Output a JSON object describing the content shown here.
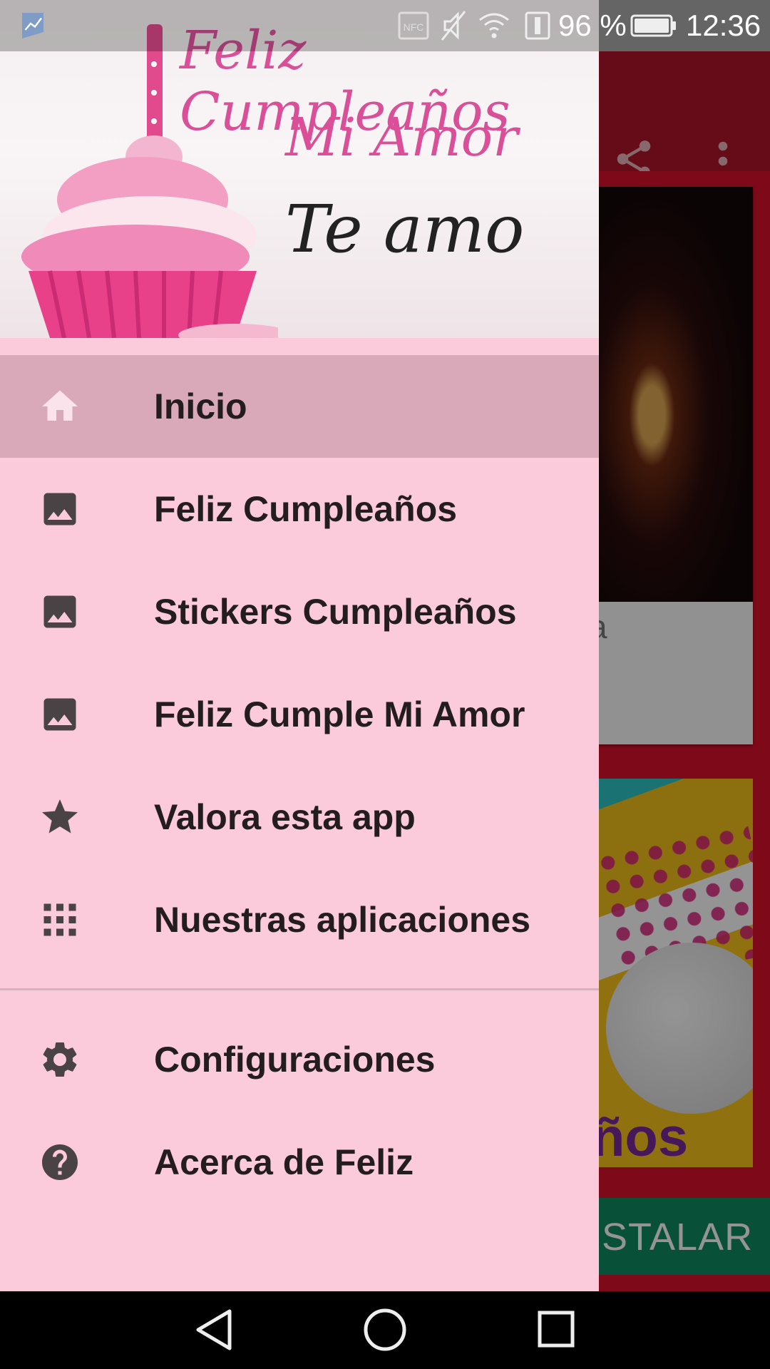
{
  "status_bar": {
    "battery_percent": "96 %",
    "time": "12:36",
    "icons": [
      "app-notification-icon",
      "nfc-icon",
      "mute-icon",
      "wifi-icon",
      "battery-saver-icon",
      "battery-icon"
    ]
  },
  "header": {
    "line1": "Feliz Cumpleaños",
    "line2": "Mi Amor",
    "line3": "Te amo"
  },
  "menu": {
    "items": [
      {
        "label": "Inicio",
        "icon": "home-icon",
        "active": true
      },
      {
        "label": "Feliz Cumpleaños",
        "icon": "image-icon",
        "active": false
      },
      {
        "label": "Stickers Cumpleaños",
        "icon": "image-icon",
        "active": false
      },
      {
        "label": "Feliz Cumple Mi Amor",
        "icon": "image-icon",
        "active": false
      },
      {
        "label": "Valora esta app",
        "icon": "star-icon",
        "active": false
      },
      {
        "label": "Nuestras aplicaciones",
        "icon": "apps-grid-icon",
        "active": false
      }
    ],
    "secondary": [
      {
        "label": "Configuraciones",
        "icon": "gear-icon"
      },
      {
        "label": "Acerca de Feliz",
        "icon": "help-icon"
      }
    ]
  },
  "background": {
    "card_caption_fragment": "a",
    "card_text_fragment": "ños",
    "install_button": "STALAR"
  },
  "colors": {
    "drawer_bg": "#fbcadb",
    "active_item_bg": "#d9a9b9",
    "appbar": "#b0162a",
    "install_button": "#0f8a60",
    "icon_gray": "#4a4346"
  }
}
